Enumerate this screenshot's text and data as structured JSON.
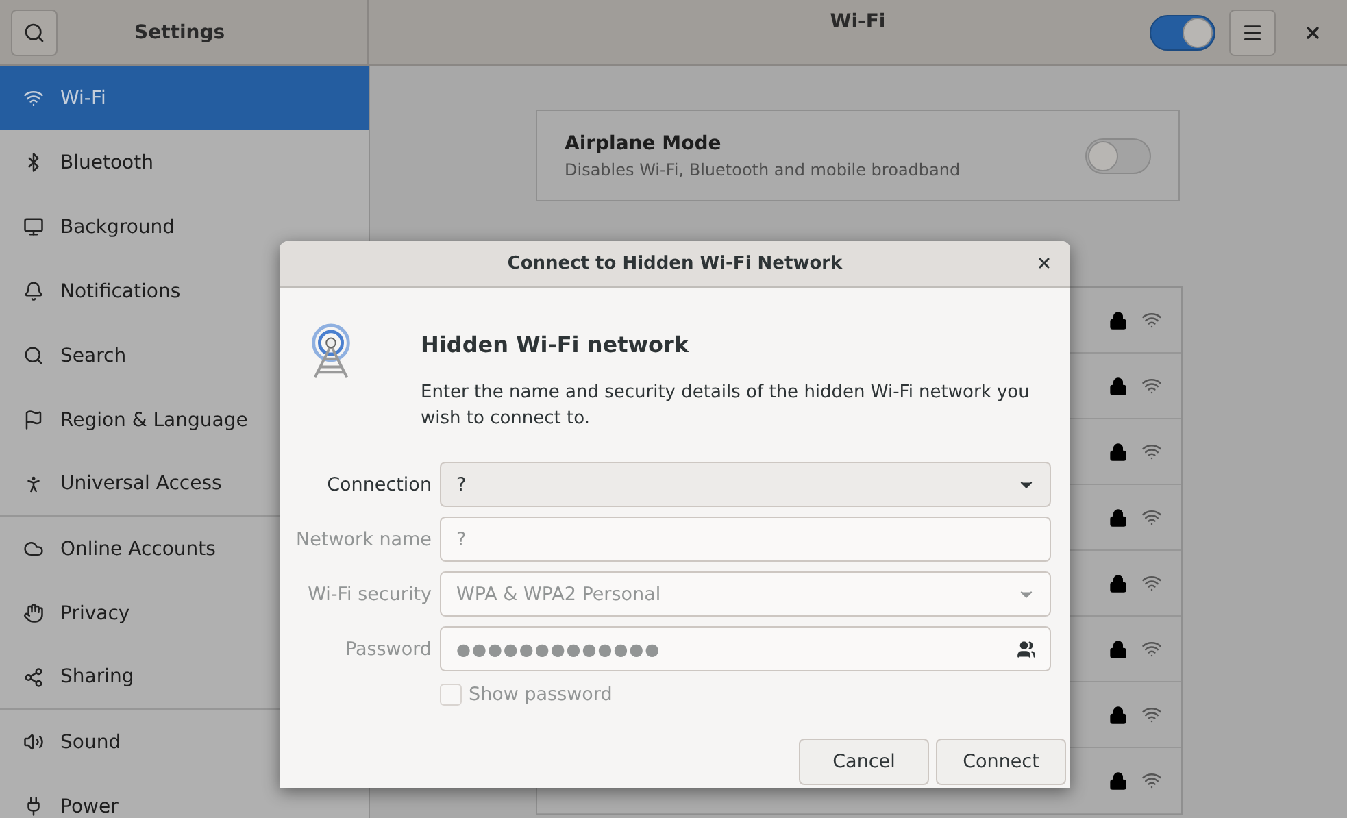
{
  "header": {
    "sidebar_title": "Settings",
    "page_title": "Wi-Fi",
    "wifi_switch": {
      "on": true
    }
  },
  "sidebar": {
    "items": [
      {
        "label": "Wi-Fi",
        "selected": true,
        "divider_after": false
      },
      {
        "label": "Bluetooth",
        "selected": false,
        "divider_after": false
      },
      {
        "label": "Background",
        "selected": false,
        "divider_after": false
      },
      {
        "label": "Notifications",
        "selected": false,
        "divider_after": false
      },
      {
        "label": "Search",
        "selected": false,
        "divider_after": false
      },
      {
        "label": "Region & Language",
        "selected": false,
        "divider_after": false
      },
      {
        "label": "Universal Access",
        "selected": false,
        "divider_after": true
      },
      {
        "label": "Online Accounts",
        "selected": false,
        "divider_after": false
      },
      {
        "label": "Privacy",
        "selected": false,
        "divider_after": false
      },
      {
        "label": "Sharing",
        "selected": false,
        "divider_after": true
      },
      {
        "label": "Sound",
        "selected": false,
        "divider_after": false
      },
      {
        "label": "Power",
        "selected": false,
        "divider_after": false
      }
    ]
  },
  "airplane_mode": {
    "title": "Airplane Mode",
    "subtitle": "Disables Wi-Fi, Bluetooth and mobile broadband",
    "on": false
  },
  "networks": [
    {
      "secured": true
    },
    {
      "secured": true
    },
    {
      "secured": true
    },
    {
      "secured": true
    },
    {
      "secured": true
    },
    {
      "secured": true
    },
    {
      "secured": true
    },
    {
      "secured": true
    }
  ],
  "dialog": {
    "title": "Connect to Hidden Wi-Fi Network",
    "heading": "Hidden Wi-Fi network",
    "description": "Enter the name and security details of the hidden Wi-Fi network you wish to connect to.",
    "fields": [
      {
        "kind": "combo",
        "label": "Connection",
        "value": "?",
        "disabled": false
      },
      {
        "kind": "text",
        "label": "Network name",
        "value": "?",
        "disabled": true
      },
      {
        "kind": "combo",
        "label": "Wi-Fi security",
        "value": "WPA & WPA2 Personal",
        "disabled": true
      },
      {
        "kind": "password",
        "label": "Password",
        "value": "●●●●●●●●●●●●●",
        "disabled": true
      }
    ],
    "show_password": {
      "label": "Show password",
      "checked": false,
      "disabled": true
    },
    "buttons": [
      "Cancel",
      "Connect"
    ]
  }
}
